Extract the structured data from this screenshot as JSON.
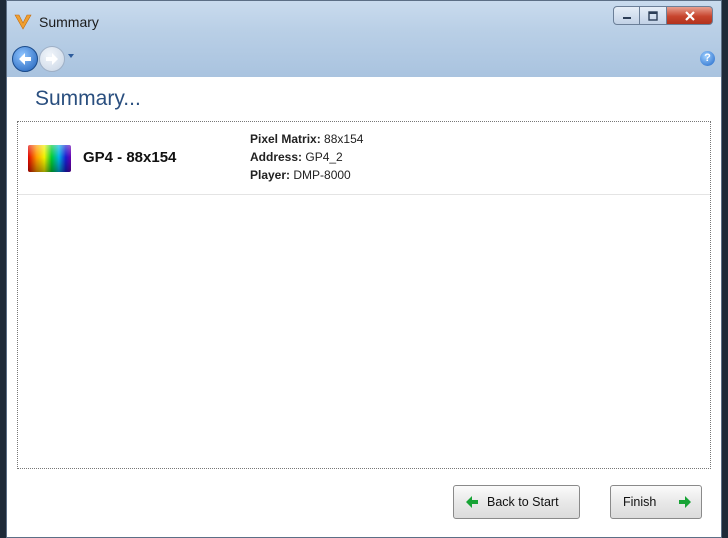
{
  "window": {
    "title": "Summary"
  },
  "header": {
    "title": "Summary..."
  },
  "item": {
    "name": "GP4 - 88x154",
    "pixel_matrix_label": "Pixel Matrix:",
    "pixel_matrix_value": "88x154",
    "address_label": "Address:",
    "address_value": "GP4_2",
    "player_label": "Player:",
    "player_value": "DMP-8000"
  },
  "footer": {
    "back_label": "Back to Start",
    "finish_label": "Finish"
  },
  "help": {
    "glyph": "?"
  },
  "icons": {
    "app": "v-logo-icon",
    "back": "back-arrow-icon",
    "forward": "forward-arrow-icon",
    "help": "help-icon",
    "minimize": "minimize-icon",
    "maximize": "maximize-icon",
    "close": "close-icon",
    "item": "rainbow-matrix-icon"
  },
  "colors": {
    "accent": "#2a4f7f",
    "arrow": "#17a335",
    "close": "#c7452e"
  }
}
